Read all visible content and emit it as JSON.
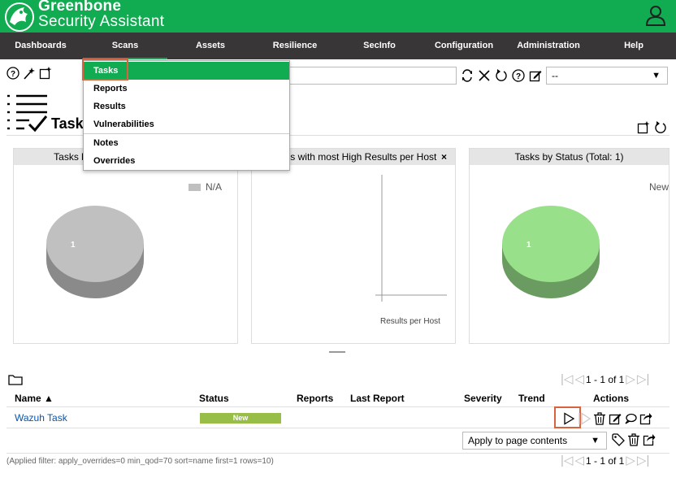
{
  "app": {
    "brand_line1": "Greenbone",
    "brand_line2": "Security Assistant",
    "accent_color": "#11ab51",
    "nav_color": "#393637",
    "highlight_color": "#d9623f"
  },
  "nav": {
    "items": [
      "Dashboards",
      "Scans",
      "Assets",
      "Resilience",
      "SecInfo",
      "Configuration",
      "Administration",
      "Help"
    ],
    "active": "Scans"
  },
  "scans_menu": {
    "items": [
      "Tasks",
      "Reports",
      "Results",
      "Vulnerabilities",
      "Notes",
      "Overrides"
    ],
    "active": "Tasks"
  },
  "toolbar": {
    "icons": [
      "help-icon",
      "wizard-icon",
      "new-task-icon"
    ]
  },
  "filter": {
    "value": "",
    "select_value": "--",
    "icons": [
      "refresh-filter-icon",
      "clear-filter-icon",
      "reset-filter-icon",
      "filter-help-icon",
      "edit-filter-icon"
    ]
  },
  "page": {
    "title": "Tasks"
  },
  "dashboards": [
    {
      "title": "Tasks by Severity Class (Total: 1)",
      "legend": "N/A",
      "legend_color": "#c0c0c0",
      "slice_label": "1",
      "pie_color": "#c0c0c0",
      "pie_side_color": "#8a8a8a"
    },
    {
      "title": "Tasks with most High Results per Host",
      "close": "×",
      "axis_label": "Results per Host"
    },
    {
      "title": "Tasks by Status (Total: 1)",
      "legend": "New",
      "legend_color": "#99e08a",
      "slice_label": "1",
      "pie_color": "#99e08a",
      "pie_side_color": "#6a9b60"
    }
  ],
  "pager": {
    "text": "1 - 1 of 1"
  },
  "table": {
    "columns": [
      "Name ▲",
      "Status",
      "Reports",
      "Last Report",
      "Severity",
      "Trend",
      "Actions"
    ],
    "rows": [
      {
        "name": "Wazuh Task",
        "status": "New",
        "status_color": "#99be48",
        "reports": "",
        "last_report": "",
        "severity": "",
        "trend": ""
      }
    ]
  },
  "bulk": {
    "select_value": "Apply to page contents"
  },
  "footer": {
    "applied_filter": "(Applied filter: apply_overrides=0 min_qod=70 sort=name first=1 rows=10)"
  }
}
